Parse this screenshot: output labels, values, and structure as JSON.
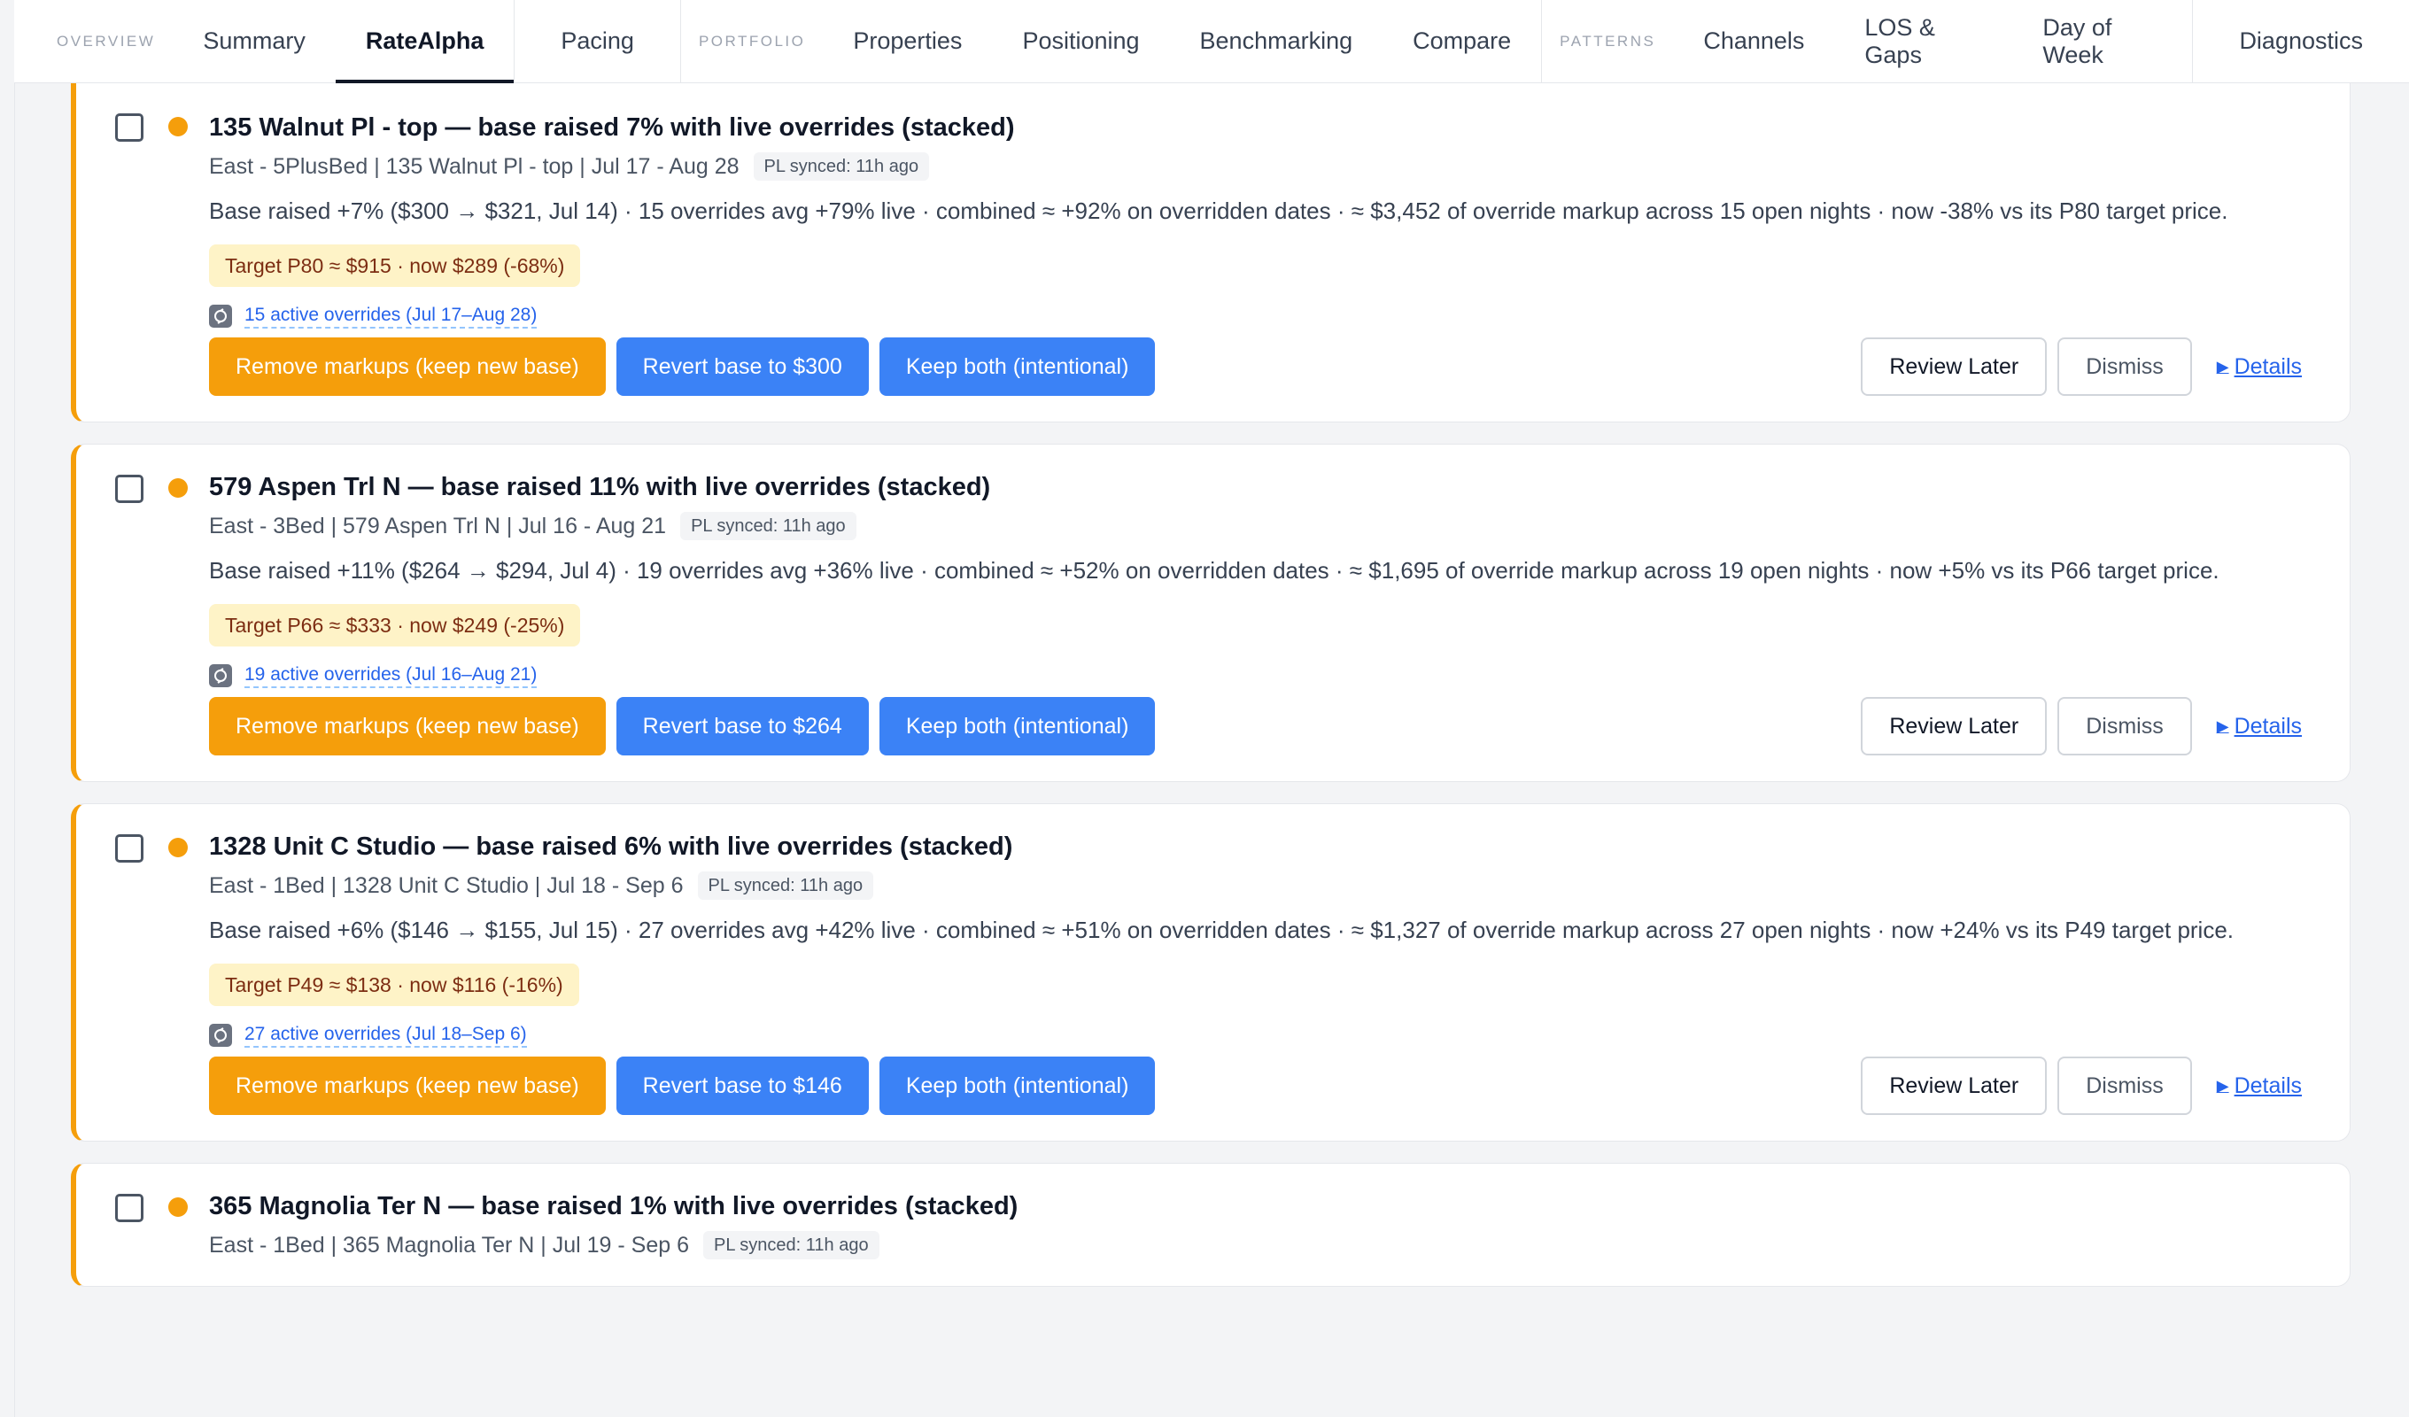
{
  "nav": {
    "groups": [
      {
        "section": "OVERVIEW",
        "tabs": [
          "Summary",
          "RateAlpha"
        ]
      },
      {
        "section": "",
        "tabs": [
          "Pacing"
        ]
      },
      {
        "section": "PORTFOLIO",
        "tabs": [
          "Properties",
          "Positioning",
          "Benchmarking",
          "Compare"
        ]
      },
      {
        "section": "PATTERNS",
        "tabs": [
          "Channels",
          "LOS & Gaps",
          "Day of Week"
        ]
      },
      {
        "section": "",
        "tabs": [
          "Diagnostics"
        ]
      }
    ],
    "active_tab": "RateAlpha"
  },
  "colors": {
    "accent_orange": "#f59e0b",
    "accent_blue": "#3b82f6",
    "link_blue": "#2563eb",
    "badge_yellow": "#fef3c7"
  },
  "actions": {
    "remove_label": "Remove markups (keep new base)",
    "keep_label": "Keep both (intentional)",
    "review_label": "Review Later",
    "dismiss_label": "Dismiss",
    "details_label": "Details"
  },
  "cards": [
    {
      "title": "135 Walnut Pl - top — base raised 7% with live overrides (stacked)",
      "meta": "East - 5PlusBed | 135 Walnut Pl - top | Jul 17 - Aug 28",
      "sync": "PL synced: 11h ago",
      "description": "Base raised +7% ($300 → $321, Jul 14) · 15 overrides avg +79% live · combined ≈ +92% on overridden dates · ≈ $3,452 of override markup across 15 open nights · now -38% vs its P80 target price.",
      "target": "Target P80 ≈ $915 · now $289 (-68%)",
      "overrides": "15 active overrides (Jul 17–Aug 28)",
      "revert_label": "Revert base to $300"
    },
    {
      "title": "579 Aspen Trl N — base raised 11% with live overrides (stacked)",
      "meta": "East - 3Bed | 579 Aspen Trl N | Jul 16 - Aug 21",
      "sync": "PL synced: 11h ago",
      "description": "Base raised +11% ($264 → $294, Jul 4) · 19 overrides avg +36% live · combined ≈ +52% on overridden dates · ≈ $1,695 of override markup across 19 open nights · now +5% vs its P66 target price.",
      "target": "Target P66 ≈ $333 · now $249 (-25%)",
      "overrides": "19 active overrides (Jul 16–Aug 21)",
      "revert_label": "Revert base to $264"
    },
    {
      "title": "1328 Unit C Studio — base raised 6% with live overrides (stacked)",
      "meta": "East - 1Bed | 1328 Unit C Studio | Jul 18 - Sep 6",
      "sync": "PL synced: 11h ago",
      "description": "Base raised +6% ($146 → $155, Jul 15) · 27 overrides avg +42% live · combined ≈ +51% on overridden dates · ≈ $1,327 of override markup across 27 open nights · now +24% vs its P49 target price.",
      "target": "Target P49 ≈ $138 · now $116 (-16%)",
      "overrides": "27 active overrides (Jul 18–Sep 6)",
      "revert_label": "Revert base to $146"
    },
    {
      "title": "365 Magnolia Ter N — base raised 1% with live overrides (stacked)",
      "meta": "East - 1Bed | 365 Magnolia Ter N | Jul 19 - Sep 6",
      "sync": "PL synced: 11h ago"
    }
  ]
}
